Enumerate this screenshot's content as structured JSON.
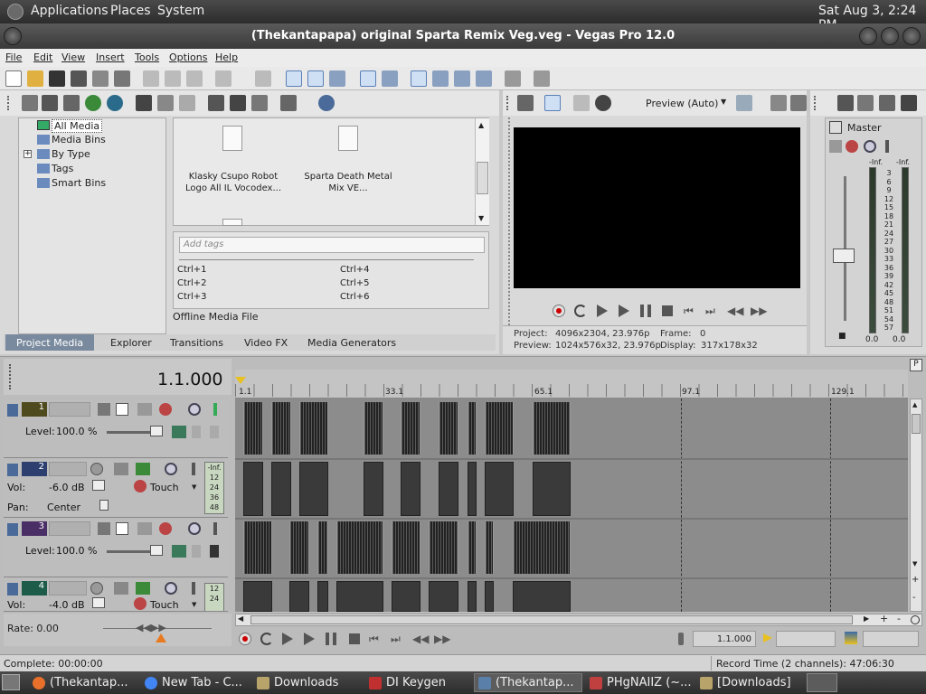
{
  "top_panel": {
    "applications": "Applications",
    "places": "Places",
    "system": "System",
    "clock": "Sat Aug  3,  2:24 PM"
  },
  "window": {
    "title": "(Thekantapapa) original Sparta Remix Veg.veg - Vegas Pro 12.0"
  },
  "menu": [
    "File",
    "Edit",
    "View",
    "Insert",
    "Tools",
    "Options",
    "Help"
  ],
  "media_tree": [
    "All Media",
    "Media Bins",
    "By Type",
    "Tags",
    "Smart Bins"
  ],
  "media_files": [
    {
      "line1": "Klasky Csupo Robot",
      "line2": "Logo All IL Vocodex..."
    },
    {
      "line1": "Sparta Death Metal",
      "line2": "Mix VE..."
    }
  ],
  "tags": {
    "placeholder": "Add tags",
    "shortcuts": [
      "Ctrl+1",
      "Ctrl+4",
      "Ctrl+2",
      "Ctrl+5",
      "Ctrl+3",
      "Ctrl+6"
    ]
  },
  "offline_label": "Offline Media File",
  "bottom_tabs": [
    "Project Media",
    "Explorer",
    "Transitions",
    "Video FX",
    "Media Generators"
  ],
  "preview": {
    "mode": "Preview (Auto)",
    "project_label": "Project:",
    "project_value": "4096x2304, 23.976p",
    "preview_label": "Preview:",
    "preview_value": "1024x576x32, 23.976p",
    "frame_label": "Frame:",
    "frame_value": "0",
    "display_label": "Display:",
    "display_value": "317x178x32"
  },
  "master": {
    "label": "Master",
    "inf_left": "-Inf.",
    "inf_right": "-Inf.",
    "scale": [
      "3",
      "6",
      "9",
      "12",
      "15",
      "18",
      "21",
      "24",
      "27",
      "30",
      "33",
      "36",
      "39",
      "42",
      "45",
      "48",
      "51",
      "54",
      "57"
    ],
    "val_left": "0.0",
    "val_right": "0.0"
  },
  "timeline": {
    "time": "1.1.000",
    "ruler": [
      "1.1",
      "33.1",
      "65.1",
      "97.1",
      "129.1"
    ],
    "rate": "Rate: 0.00",
    "complete": "Complete: 00:00:00",
    "record_time": "Record Time (2 channels): 47:06:30",
    "cursor": "1.1.000"
  },
  "tracks": [
    {
      "num": "1",
      "type": "video",
      "color": "#4f4a1e",
      "level_label": "Level:",
      "level": "100.0 %"
    },
    {
      "num": "2",
      "type": "audio",
      "color": "#2c3f6e",
      "vol_label": "Vol:",
      "vol": "-6.0 dB",
      "pan_label": "Pan:",
      "pan": "Center",
      "mode": "Touch",
      "meter": [
        "-Inf.",
        "12",
        "24",
        "36",
        "48"
      ]
    },
    {
      "num": "3",
      "type": "video",
      "color": "#4a2e66",
      "level_label": "Level:",
      "level": "100.0 %"
    },
    {
      "num": "4",
      "type": "audio",
      "color": "#1e5c4a",
      "vol_label": "Vol:",
      "vol": "-4.0 dB",
      "mode": "Touch",
      "meter": [
        "12",
        "24"
      ]
    }
  ],
  "taskbar": [
    {
      "label": "(Thekantap...",
      "icon": "firefox-icon",
      "color": "#e8702a"
    },
    {
      "label": "New Tab - C...",
      "icon": "chrome-icon",
      "color": "#4285f4"
    },
    {
      "label": "Downloads",
      "icon": "folder-icon",
      "color": "#b8a36a"
    },
    {
      "label": "DI Keygen",
      "icon": "keygen-icon",
      "color": "#c03030"
    },
    {
      "label": "(Thekantap...",
      "icon": "vegas-icon",
      "color": "#5a7fa8"
    },
    {
      "label": "PHgNAIIZ (~...",
      "icon": "editor-icon",
      "color": "#c04040"
    },
    {
      "label": "[Downloads]",
      "icon": "folder-icon",
      "color": "#b8a36a"
    }
  ]
}
